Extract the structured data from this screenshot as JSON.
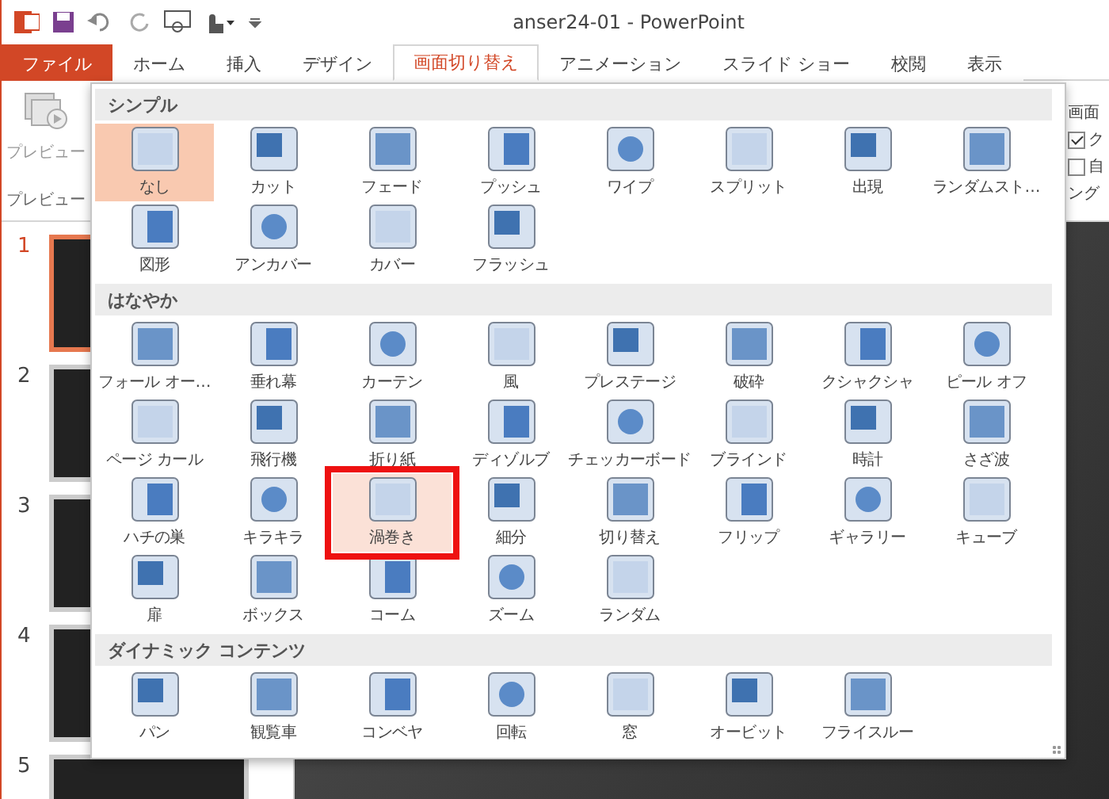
{
  "window": {
    "title": "anser24-01 - PowerPoint"
  },
  "tabs": [
    {
      "label": "ファイル",
      "kind": "file",
      "selected": false
    },
    {
      "label": "ホーム",
      "kind": "tab",
      "selected": false
    },
    {
      "label": "挿入",
      "kind": "tab",
      "selected": false
    },
    {
      "label": "デザイン",
      "kind": "tab",
      "selected": false
    },
    {
      "label": "画面切り替え",
      "kind": "tab",
      "selected": true
    },
    {
      "label": "アニメーション",
      "kind": "tab",
      "selected": false
    },
    {
      "label": "スライド ショー",
      "kind": "tab",
      "selected": false
    },
    {
      "label": "校閲",
      "kind": "tab",
      "selected": false
    },
    {
      "label": "表示",
      "kind": "tab",
      "selected": false
    }
  ],
  "ribbon": {
    "preview_button": "プレビュー",
    "preview_group": "プレビュー",
    "right_title": "画面",
    "options": [
      {
        "label": "ク",
        "checked": true
      },
      {
        "label": "自",
        "checked": false
      }
    ],
    "right_group": "ング"
  },
  "slides": [
    {
      "number": "1",
      "selected": true
    },
    {
      "number": "2",
      "selected": false
    },
    {
      "number": "3",
      "selected": false
    },
    {
      "number": "4",
      "selected": false
    },
    {
      "number": "5",
      "selected": false
    }
  ],
  "gallery": {
    "sections": [
      {
        "title": "シンプル",
        "items": [
          {
            "label": "なし",
            "selected": true,
            "marked": false
          },
          {
            "label": "カット",
            "selected": false,
            "marked": false
          },
          {
            "label": "フェード",
            "selected": false,
            "marked": false
          },
          {
            "label": "プッシュ",
            "selected": false,
            "marked": false
          },
          {
            "label": "ワイプ",
            "selected": false,
            "marked": false
          },
          {
            "label": "スプリット",
            "selected": false,
            "marked": false
          },
          {
            "label": "出現",
            "selected": false,
            "marked": false
          },
          {
            "label": "ランダムスト…",
            "selected": false,
            "marked": false
          },
          {
            "label": "図形",
            "selected": false,
            "marked": false
          },
          {
            "label": "アンカバー",
            "selected": false,
            "marked": false
          },
          {
            "label": "カバー",
            "selected": false,
            "marked": false
          },
          {
            "label": "フラッシュ",
            "selected": false,
            "marked": false
          }
        ]
      },
      {
        "title": "はなやか",
        "items": [
          {
            "label": "フォール オー…",
            "selected": false,
            "marked": false
          },
          {
            "label": "垂れ幕",
            "selected": false,
            "marked": false
          },
          {
            "label": "カーテン",
            "selected": false,
            "marked": false
          },
          {
            "label": "風",
            "selected": false,
            "marked": false
          },
          {
            "label": "プレステージ",
            "selected": false,
            "marked": false
          },
          {
            "label": "破砕",
            "selected": false,
            "marked": false
          },
          {
            "label": "クシャクシャ",
            "selected": false,
            "marked": false
          },
          {
            "label": "ピール オフ",
            "selected": false,
            "marked": false
          },
          {
            "label": "ページ カール",
            "selected": false,
            "marked": false
          },
          {
            "label": "飛行機",
            "selected": false,
            "marked": false
          },
          {
            "label": "折り紙",
            "selected": false,
            "marked": false
          },
          {
            "label": "ディゾルブ",
            "selected": false,
            "marked": false
          },
          {
            "label": "チェッカーボード",
            "selected": false,
            "marked": false
          },
          {
            "label": "ブラインド",
            "selected": false,
            "marked": false
          },
          {
            "label": "時計",
            "selected": false,
            "marked": false
          },
          {
            "label": "さざ波",
            "selected": false,
            "marked": false
          },
          {
            "label": "ハチの巣",
            "selected": false,
            "marked": false
          },
          {
            "label": "キラキラ",
            "selected": false,
            "marked": false
          },
          {
            "label": "渦巻き",
            "selected": false,
            "marked": true
          },
          {
            "label": "細分",
            "selected": false,
            "marked": false
          },
          {
            "label": "切り替え",
            "selected": false,
            "marked": false
          },
          {
            "label": "フリップ",
            "selected": false,
            "marked": false
          },
          {
            "label": "ギャラリー",
            "selected": false,
            "marked": false
          },
          {
            "label": "キューブ",
            "selected": false,
            "marked": false
          },
          {
            "label": "扉",
            "selected": false,
            "marked": false
          },
          {
            "label": "ボックス",
            "selected": false,
            "marked": false
          },
          {
            "label": "コーム",
            "selected": false,
            "marked": false
          },
          {
            "label": "ズーム",
            "selected": false,
            "marked": false
          },
          {
            "label": "ランダム",
            "selected": false,
            "marked": false
          }
        ]
      },
      {
        "title": "ダイナミック コンテンツ",
        "items": [
          {
            "label": "パン",
            "selected": false,
            "marked": false
          },
          {
            "label": "観覧車",
            "selected": false,
            "marked": false
          },
          {
            "label": "コンベヤ",
            "selected": false,
            "marked": false
          },
          {
            "label": "回転",
            "selected": false,
            "marked": false
          },
          {
            "label": "窓",
            "selected": false,
            "marked": false
          },
          {
            "label": "オービット",
            "selected": false,
            "marked": false
          },
          {
            "label": "フライスルー",
            "selected": false,
            "marked": false
          }
        ]
      }
    ]
  }
}
